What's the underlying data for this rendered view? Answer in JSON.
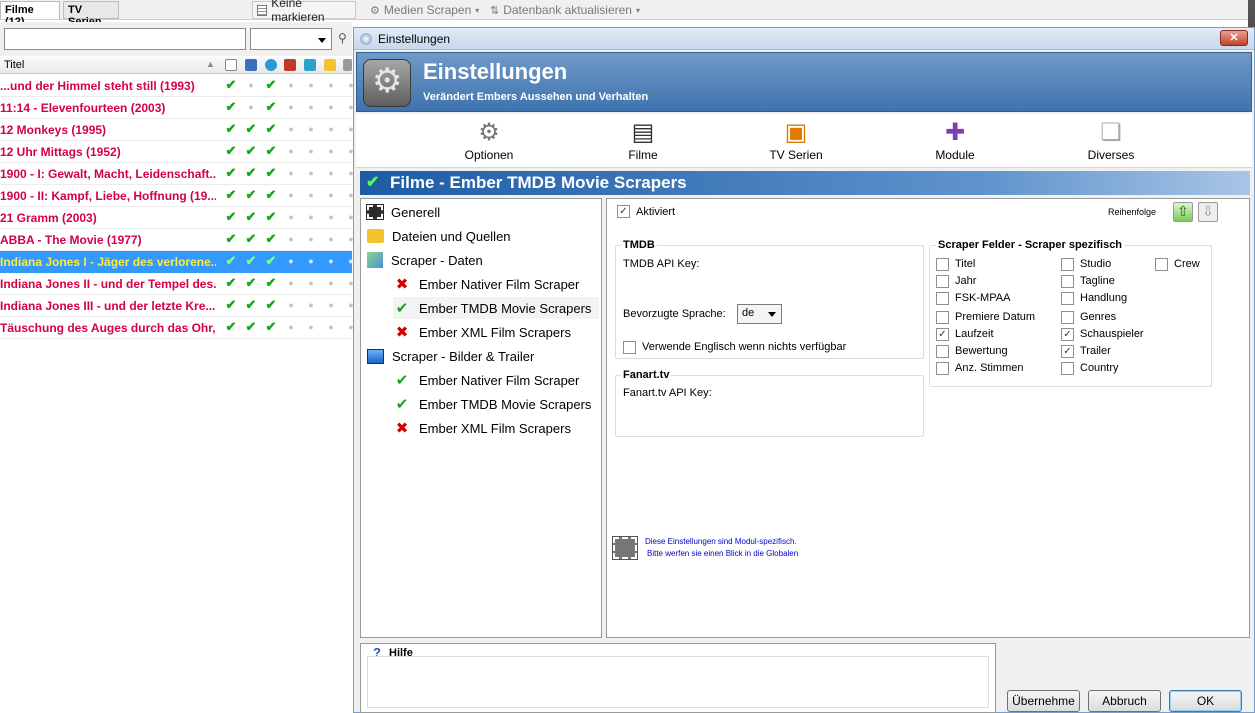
{
  "toolbar": {
    "tab_filme": "Filme (12)",
    "tab_tv": "TV Serien",
    "keine_markieren": "Keine markieren",
    "medien_scrapen": "Medien Scrapen",
    "datenbank_aktualisieren": "Datenbank aktualisieren"
  },
  "list": {
    "column_title": "Titel",
    "rows": [
      {
        "title": "...und der Himmel steht still (1993)",
        "marks": [
          "check",
          "dot",
          "check",
          "dot",
          "dot",
          "dot",
          "dot"
        ]
      },
      {
        "title": "11:14 - Elevenfourteen (2003)",
        "marks": [
          "check",
          "dot",
          "check",
          "dot",
          "dot",
          "dot",
          "dot"
        ]
      },
      {
        "title": "12 Monkeys (1995)",
        "marks": [
          "check",
          "check",
          "check",
          "dot",
          "dot",
          "dot",
          "dot"
        ]
      },
      {
        "title": "12 Uhr Mittags (1952)",
        "marks": [
          "check",
          "check",
          "check",
          "dot",
          "dot",
          "dot",
          "dot"
        ]
      },
      {
        "title": "1900 - I: Gewalt, Macht, Leidenschaft...",
        "marks": [
          "check",
          "check",
          "check",
          "dot",
          "dot",
          "dot",
          "dot"
        ]
      },
      {
        "title": "1900 - II: Kampf, Liebe, Hoffnung (19...",
        "marks": [
          "check",
          "check",
          "check",
          "dot",
          "dot",
          "dot",
          "dot"
        ]
      },
      {
        "title": "21 Gramm (2003)",
        "marks": [
          "check",
          "check",
          "check",
          "dot",
          "dot",
          "dot",
          "dot"
        ]
      },
      {
        "title": "ABBA - The Movie (1977)",
        "marks": [
          "check",
          "check",
          "check",
          "dot",
          "dot",
          "dot",
          "dot"
        ]
      },
      {
        "title": "Indiana Jones I - Jäger des verlorene...",
        "marks": [
          "check",
          "check",
          "check",
          "dot",
          "dot",
          "dot",
          "dot"
        ],
        "selected": true
      },
      {
        "title": "Indiana Jones II - und der Tempel des...",
        "marks": [
          "check",
          "check",
          "check",
          "dot",
          "dot",
          "dot",
          "dot"
        ]
      },
      {
        "title": "Indiana Jones III - und der letzte Kre...",
        "marks": [
          "check",
          "check",
          "check",
          "dot",
          "dot",
          "dot",
          "dot"
        ]
      },
      {
        "title": "Täuschung des Auges durch das Ohr, ...",
        "marks": [
          "check",
          "check",
          "check",
          "dot",
          "dot",
          "dot",
          "dot"
        ]
      }
    ]
  },
  "window": {
    "title": "Einstellungen",
    "banner_title": "Einstellungen",
    "banner_subtitle": "Verändert Embers Aussehen und Verhalten",
    "close_label": "✕",
    "categories": [
      {
        "label": "Optionen",
        "icon": "gear-icon"
      },
      {
        "label": "Filme",
        "icon": "film-icon"
      },
      {
        "label": "TV Serien",
        "icon": "tv-icon"
      },
      {
        "label": "Module",
        "icon": "puzzle-icon"
      },
      {
        "label": "Diverses",
        "icon": "misc-icon"
      }
    ],
    "section_title": "Filme - Ember TMDB Movie Scrapers",
    "tree": {
      "generell": "Generell",
      "dateien": "Dateien und Quellen",
      "scraper_daten": "Scraper - Daten",
      "daten_native": "Ember Nativer Film Scraper",
      "daten_tmdb": "Ember TMDB Movie Scrapers",
      "daten_xml": "Ember XML Film Scrapers",
      "scraper_bilder": "Scraper - Bilder & Trailer",
      "bilder_native": "Ember Nativer Film Scraper",
      "bilder_tmdb": "Ember TMDB Movie Scrapers",
      "bilder_xml": "Ember XML Film Scrapers"
    },
    "settings": {
      "aktiviert": "Aktiviert",
      "reihenfolge": "Reihenfolge",
      "tmdb_group": "TMDB",
      "tmdb_api_key": "TMDB API Key:",
      "bevorzugte_sprache": "Bevorzugte Sprache:",
      "sprache_value": "de",
      "verwende_englisch": "Verwende Englisch wenn nichts verfügbar",
      "fanart_group": "Fanart.tv",
      "fanart_api_key": "Fanart.tv API Key:",
      "scraper_felder": "Scraper Felder - Scraper spezifisch",
      "fields_col1": [
        {
          "label": "Titel",
          "checked": false
        },
        {
          "label": "Jahr",
          "checked": false
        },
        {
          "label": "FSK-MPAA",
          "checked": false
        },
        {
          "label": "Premiere Datum",
          "checked": false
        },
        {
          "label": "Laufzeit",
          "checked": true
        },
        {
          "label": "Bewertung",
          "checked": false
        },
        {
          "label": "Anz. Stimmen",
          "checked": false
        }
      ],
      "fields_col2": [
        {
          "label": "Studio",
          "checked": false
        },
        {
          "label": "Tagline",
          "checked": false
        },
        {
          "label": "Handlung",
          "checked": false
        },
        {
          "label": "Genres",
          "checked": false
        },
        {
          "label": "Schauspieler",
          "checked": true
        },
        {
          "label": "Trailer",
          "checked": true
        },
        {
          "label": "Country",
          "checked": false
        }
      ],
      "crew": "Crew",
      "note_line1": "Diese Einstellungen sind Modul-spezifisch.",
      "note_line2": "Bitte werfen sie einen Blick in die Globalen"
    },
    "hilfe": "Hilfe",
    "buttons": {
      "uebernehme": "Übernehme",
      "abbruch": "Abbruch",
      "ok": "OK"
    }
  },
  "colors": {
    "title_red": "#d4004a",
    "selection_blue": "#3399ff",
    "banner_blue": "#3f73ae",
    "check_green": "#18a818"
  }
}
